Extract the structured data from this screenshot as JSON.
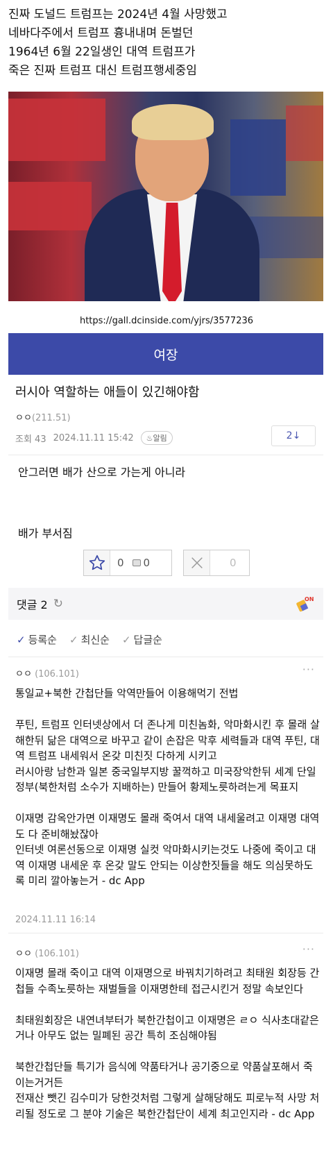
{
  "intro": {
    "lines": [
      "진짜 도널드 트럼프는 2024년 4월 사망했고",
      "네바다주에서 트럼프 흉내내며 돈벌던",
      "1964년 6월 22일생인 대역 트럼프가",
      "죽은 진짜 트럼프 대신 트럼프행세중임"
    ]
  },
  "source_url": "https://gall.dcinside.com/yjrs/3577236",
  "gallery_name": "여장",
  "post": {
    "title": "러시아 역할하는 애들이 있긴해야함",
    "author": "ㅇㅇ",
    "author_ip": "(211.51)",
    "views": "조회 43",
    "date": "2024.11.11 15:42",
    "alarm": "알림",
    "reply_count": "2↓",
    "body_line1": "안그러면 배가 산으로 가는게 아니라",
    "body_line2": "배가 부서짐",
    "upvotes": "0",
    "fixed_upvotes": "0",
    "downvotes": "0"
  },
  "comments_header": {
    "label": "댓글 2"
  },
  "sort_options": [
    "등록순",
    "최신순",
    "답글순"
  ],
  "comments": [
    {
      "author": "ㅇㅇ",
      "ip": "(106.101)",
      "paragraphs": [
        "통일교+북한 간첩단들 악역만들어 이용해먹기 전법",
        "푸틴, 트럼프 인터넷상에서 더 존나게 미친놈화, 악마화시킨 후 몰래 살해한뒤 닮은 대역으로 바꾸고 같이 손잡은 막후 세력들과 대역 푸틴, 대역 트럼프 내세워서 온갖 미친짓 다하게 시키고\n러시아랑 남한과 일본 중국일부지방 꿀꺽하고 미국장악한뒤 세계 단일 정부(북한처럼 소수가 지배하는) 만들어 황제노릇하려는게 목표지",
        "이재명 감옥안가면 이재명도 몰래 죽여서 대역 내세울려고 이재명 대역도 다 준비해놨잖아\n인터넷 여론선동으로 이재명 실컷 악마화시키는것도 나중에 죽이고 대역 이재명 내세운 후 온갖 말도 안되는 이상한짓들을 해도 의심못하도록 미리 깔아놓는거 - dc App"
      ],
      "date": "2024.11.11 16:14"
    },
    {
      "author": "ㅇㅇ",
      "ip": "(106.101)",
      "paragraphs": [
        "이재명 몰래 죽이고 대역 이재명으로 바꿔치기하려고 최태원 회장등 간첩들 수족노릇하는 재벌들을 이재명한테 접근시킨거 정말 속보인다",
        "최태원회장은 내연녀부터가 북한간첩이고 이재명은 ㄹㅇ 식사초대같은거나 아무도 없는 밀폐된 공간 특히 조심해야됨",
        "북한간첩단들 특기가 음식에 약품타거나 공기중으로 약품살포해서 죽이는거거든\n전재산 뺏긴 김수미가 당한것처럼 그렇게 살해당해도 피로누적 사망 처리될 정도로 그 분야 기술은 북한간첩단이 세계 최고인지라 - dc App"
      ]
    }
  ],
  "colors": {
    "gallery_header": "#3c4aa8",
    "accent": "#3c4aa8"
  },
  "icons": {
    "refresh": "refresh-icon",
    "star": "star-icon",
    "fixed_vote": "fixed-upvote-icon",
    "cross": "downvote-icon",
    "on_badge": "broom-on-icon",
    "more": "more-icon"
  }
}
